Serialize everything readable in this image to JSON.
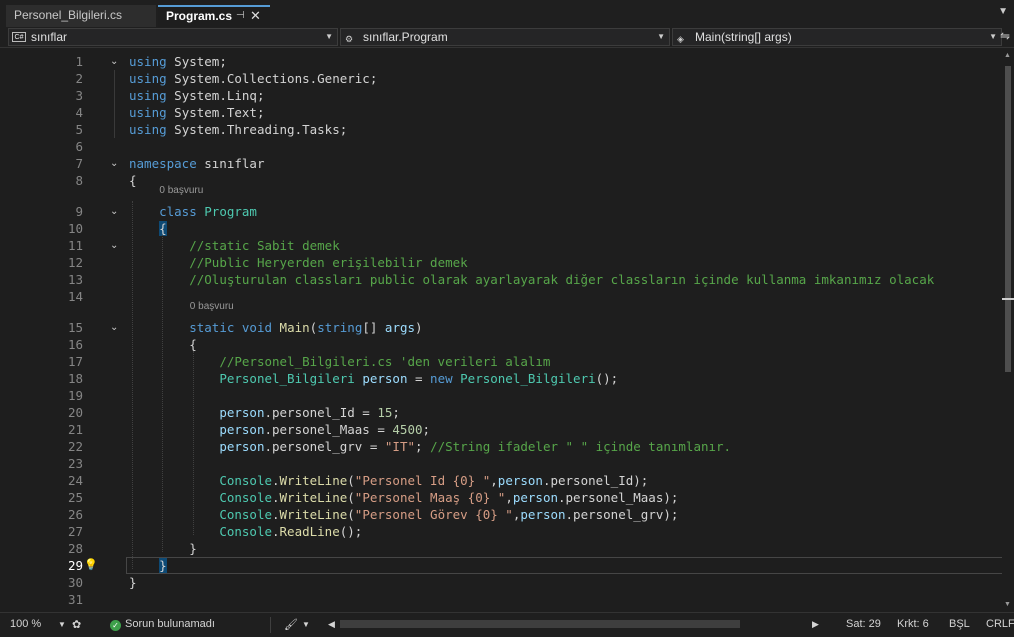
{
  "tabs": [
    {
      "label": "Personel_Bilgileri.cs",
      "active": false
    },
    {
      "label": "Program.cs",
      "active": true
    }
  ],
  "tab_icons": {
    "pin": "pin-icon",
    "close": "close-icon"
  },
  "navbar": {
    "project": "sınıflar",
    "class": "sınıflar.Program",
    "member": "Main(string[] args)"
  },
  "code_lines": [
    {
      "n": "1",
      "t": [
        [
          "kw",
          "using"
        ],
        [
          "pl",
          " System;"
        ]
      ]
    },
    {
      "n": "2",
      "t": [
        [
          "kw",
          "using"
        ],
        [
          "pl",
          " System.Collections.Generic;"
        ]
      ]
    },
    {
      "n": "3",
      "t": [
        [
          "kw",
          "using"
        ],
        [
          "pl",
          " System.Linq;"
        ]
      ]
    },
    {
      "n": "4",
      "t": [
        [
          "kw",
          "using"
        ],
        [
          "pl",
          " System.Text;"
        ]
      ]
    },
    {
      "n": "5",
      "t": [
        [
          "kw",
          "using"
        ],
        [
          "pl",
          " System.Threading.Tasks;"
        ]
      ]
    },
    {
      "n": "6",
      "t": []
    },
    {
      "n": "7",
      "t": [
        [
          "kw",
          "namespace"
        ],
        [
          "pl",
          " sınıflar"
        ]
      ]
    },
    {
      "n": "8",
      "t": [
        [
          "pl",
          "{"
        ]
      ]
    },
    {
      "n": "9",
      "t": [
        [
          "pl",
          "    "
        ],
        [
          "kw",
          "class"
        ],
        [
          "pl",
          " "
        ],
        [
          "ty",
          "Program"
        ]
      ],
      "hint": "0 başvuru"
    },
    {
      "n": "10",
      "t": [
        [
          "pl",
          "    "
        ],
        [
          "bh",
          "{"
        ]
      ]
    },
    {
      "n": "11",
      "t": [
        [
          "pl",
          "        "
        ],
        [
          "cm",
          "//static Sabit demek"
        ]
      ]
    },
    {
      "n": "12",
      "t": [
        [
          "pl",
          "        "
        ],
        [
          "cm",
          "//Public Heryerden erişilebilir demek"
        ]
      ]
    },
    {
      "n": "13",
      "t": [
        [
          "pl",
          "        "
        ],
        [
          "cm",
          "//Oluşturulan classları public olarak ayarlayarak diğer classların içinde kullanma imkanımız olacak"
        ]
      ]
    },
    {
      "n": "14",
      "t": []
    },
    {
      "n": "15",
      "t": [
        [
          "pl",
          "        "
        ],
        [
          "kw",
          "static"
        ],
        [
          "pl",
          " "
        ],
        [
          "kw",
          "void"
        ],
        [
          "pl",
          " "
        ],
        [
          "fn",
          "Main"
        ],
        [
          "pl",
          "("
        ],
        [
          "kw",
          "string"
        ],
        [
          "pl",
          "[] "
        ],
        [
          "var",
          "args"
        ],
        [
          "pl",
          ")"
        ]
      ],
      "hint": "0 başvuru"
    },
    {
      "n": "16",
      "t": [
        [
          "pl",
          "        {"
        ]
      ]
    },
    {
      "n": "17",
      "t": [
        [
          "pl",
          "            "
        ],
        [
          "cm",
          "//Personel_Bilgileri.cs 'den verileri alalım"
        ]
      ]
    },
    {
      "n": "18",
      "t": [
        [
          "pl",
          "            "
        ],
        [
          "ty",
          "Personel_Bilgileri"
        ],
        [
          "pl",
          " "
        ],
        [
          "var",
          "person"
        ],
        [
          "pl",
          " = "
        ],
        [
          "kw",
          "new"
        ],
        [
          "pl",
          " "
        ],
        [
          "ty",
          "Personel_Bilgileri"
        ],
        [
          "pl",
          "();"
        ]
      ]
    },
    {
      "n": "19",
      "t": []
    },
    {
      "n": "20",
      "t": [
        [
          "pl",
          "            "
        ],
        [
          "var",
          "person"
        ],
        [
          "pl",
          ".personel_Id = "
        ],
        [
          "num",
          "15"
        ],
        [
          "pl",
          ";"
        ]
      ]
    },
    {
      "n": "21",
      "t": [
        [
          "pl",
          "            "
        ],
        [
          "var",
          "person"
        ],
        [
          "pl",
          ".personel_Maas = "
        ],
        [
          "num",
          "4500"
        ],
        [
          "pl",
          ";"
        ]
      ]
    },
    {
      "n": "22",
      "t": [
        [
          "pl",
          "            "
        ],
        [
          "var",
          "person"
        ],
        [
          "pl",
          ".personel_grv = "
        ],
        [
          "str",
          "\"IT\""
        ],
        [
          "pl",
          "; "
        ],
        [
          "cm",
          "//String ifadeler \" \" içinde tanımlanır."
        ]
      ]
    },
    {
      "n": "23",
      "t": []
    },
    {
      "n": "24",
      "t": [
        [
          "pl",
          "            "
        ],
        [
          "ty",
          "Console"
        ],
        [
          "pl",
          "."
        ],
        [
          "fn",
          "WriteLine"
        ],
        [
          "pl",
          "("
        ],
        [
          "str",
          "\"Personel Id {0} \""
        ],
        [
          "pl",
          ","
        ],
        [
          "var",
          "person"
        ],
        [
          "pl",
          ".personel_Id);"
        ]
      ]
    },
    {
      "n": "25",
      "t": [
        [
          "pl",
          "            "
        ],
        [
          "ty",
          "Console"
        ],
        [
          "pl",
          "."
        ],
        [
          "fn",
          "WriteLine"
        ],
        [
          "pl",
          "("
        ],
        [
          "str",
          "\"Personel Maaş {0} \""
        ],
        [
          "pl",
          ","
        ],
        [
          "var",
          "person"
        ],
        [
          "pl",
          ".personel_Maas);"
        ]
      ]
    },
    {
      "n": "26",
      "t": [
        [
          "pl",
          "            "
        ],
        [
          "ty",
          "Console"
        ],
        [
          "pl",
          "."
        ],
        [
          "fn",
          "WriteLine"
        ],
        [
          "pl",
          "("
        ],
        [
          "str",
          "\"Personel Görev {0} \""
        ],
        [
          "pl",
          ","
        ],
        [
          "var",
          "person"
        ],
        [
          "pl",
          ".personel_grv);"
        ]
      ]
    },
    {
      "n": "27",
      "t": [
        [
          "pl",
          "            "
        ],
        [
          "ty",
          "Console"
        ],
        [
          "pl",
          "."
        ],
        [
          "fn",
          "ReadLine"
        ],
        [
          "pl",
          "();"
        ]
      ]
    },
    {
      "n": "28",
      "t": [
        [
          "pl",
          "        }"
        ]
      ]
    },
    {
      "n": "29",
      "t": [
        [
          "pl",
          "    "
        ],
        [
          "bh",
          "}"
        ]
      ],
      "current": true
    },
    {
      "n": "30",
      "t": [
        [
          "pl",
          "}"
        ]
      ]
    },
    {
      "n": "31",
      "t": []
    }
  ],
  "status": {
    "zoom": "100 %",
    "issues": "Sorun bulunamadı",
    "line": "Sat: 29",
    "col": "Krkt: 6",
    "mode": "BŞL",
    "eol": "CRLF"
  },
  "colors": {
    "keyword": "#569cd6",
    "type": "#4ec9b0",
    "method": "#dcdcaa",
    "string": "#d69d85",
    "number": "#b5cea8",
    "comment": "#57a64a",
    "variable": "#9cdcfe"
  }
}
